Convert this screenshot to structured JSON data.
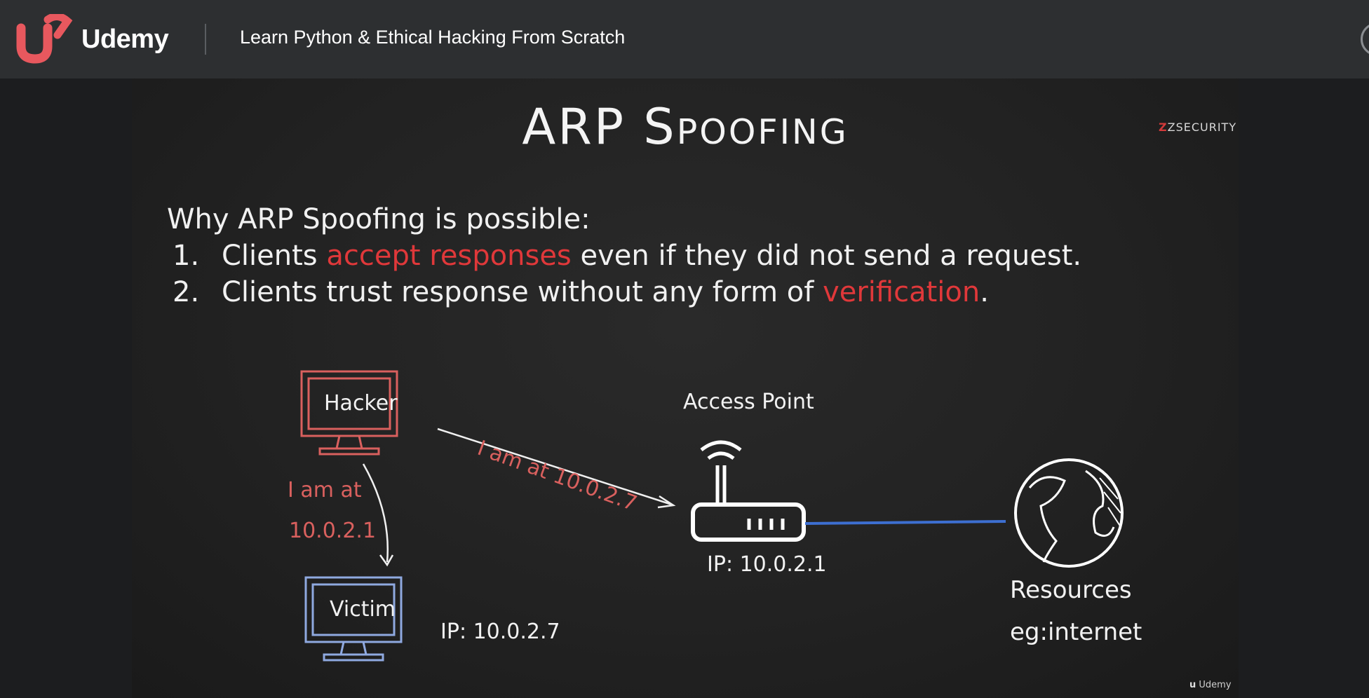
{
  "header": {
    "brand": "Udemy",
    "course_title": "Learn Python & Ethical Hacking From Scratch"
  },
  "slide": {
    "title": "ARP Spoofing",
    "brand_mark": "ZSECURITY",
    "intro": "Why ARP Spoofing is possible:",
    "points": [
      {
        "num": "1.",
        "pre": "Clients ",
        "highlight": "accept responses",
        "post": " even if they did not send a request."
      },
      {
        "num": "2.",
        "pre": "Clients trust response without any form of ",
        "highlight": "verification",
        "post": "."
      }
    ],
    "diagram": {
      "hacker_label": "Hacker",
      "victim_label": "Victim",
      "victim_ip": "IP: 10.0.2.7",
      "access_point_label": "Access Point",
      "access_point_ip": "IP: 10.0.2.1",
      "msg_to_ap": "I am at 10.0.2.7",
      "msg_to_victim_line1": "I am at",
      "msg_to_victim_line2": "10.0.2.1",
      "resources_label": "Resources",
      "resources_sub": "eg:internet"
    },
    "watermark": "Udemy"
  },
  "colors": {
    "accent_red": "#e0383a",
    "hacker_red": "#d9605e",
    "victim_blue": "#8fa9e0",
    "link_blue": "#3d6fd1",
    "topbar": "#2d2f31"
  }
}
